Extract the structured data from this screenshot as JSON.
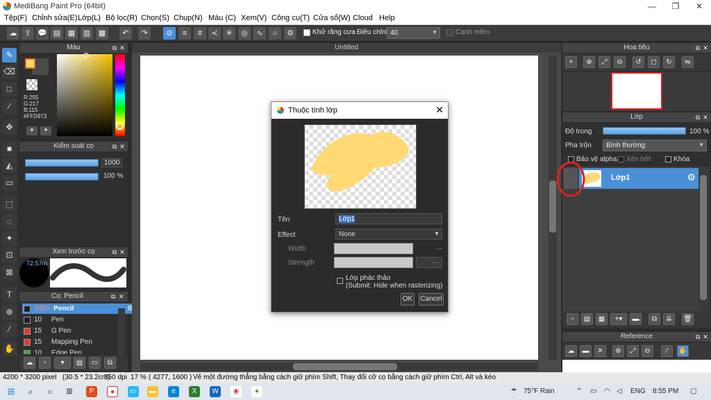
{
  "app": {
    "title": "MediBang Paint Pro (64bit)",
    "window_buttons": [
      "—",
      "❐",
      "✕"
    ]
  },
  "menu": [
    "Tệp(F)",
    "Chỉnh sửa(E)",
    "Lớp(L)",
    "Bộ lọc(R)",
    "Chọn(S)",
    "Chụp(N)",
    "Màu (C)",
    "Xem(V)",
    "Công cụ(T)",
    "Cửa sổ(W)",
    "Cloud",
    "Help"
  ],
  "toolbar": {
    "antialias_label": "Khử răng cưa",
    "adjust_label": "Điều chỉnh",
    "adjust_value": "40",
    "soft_edge_label": "Cạnh mềm"
  },
  "color_panel": {
    "title": "Màu",
    "r": "R:255",
    "g": "G:217",
    "b": "B:115",
    "hex": "#FFD973",
    "colors": {
      "primary": "#FFD973",
      "secondary": "#4a4a4a"
    }
  },
  "brush_control": {
    "title": "Kiểm soát cọ",
    "size": "1000",
    "opacity": "100 %"
  },
  "brush_preview": {
    "title": "Xem trước cọ",
    "size_label": "72.57m"
  },
  "brush_list": {
    "title": "Cọ: Pencil",
    "items": [
      {
        "size": "1000",
        "name": "Pencil",
        "color": "#222222",
        "selected": true
      },
      {
        "size": "10",
        "name": "Pen",
        "color": "#222222",
        "selected": false
      },
      {
        "size": "15",
        "name": "G Pen",
        "color": "#e53935",
        "selected": false
      },
      {
        "size": "15",
        "name": "Mapping Pen",
        "color": "#e53935",
        "selected": false
      },
      {
        "size": "10",
        "name": "Edge Pen",
        "color": "#43a047",
        "selected": false
      }
    ]
  },
  "canvas": {
    "tab_title": "Untitled"
  },
  "dialog": {
    "title": "Thuộc tính lớp",
    "name_label": "Tên",
    "name_value": "Lớp1",
    "effect_label": "Effect",
    "effect_value": "None",
    "width_label": "Width",
    "width_value": "---",
    "strength_label": "Strength",
    "strength_value": "---",
    "draft_label": "Lớp phác thảo",
    "draft_sub": "(Submit: Hide when rasterizing)",
    "ok": "OK",
    "cancel": "Cancel"
  },
  "navigator": {
    "title": "Hoa tiêu"
  },
  "layer_panel": {
    "title": "Lớp",
    "opacity_label": "Độ trong",
    "opacity_value": "100 %",
    "blend_label": "Pha trộn",
    "blend_value": "Bình thường",
    "protect_alpha": "Bảo vệ alpha",
    "clipping": "Xén bớt",
    "lock": "Khóa",
    "layer_name": "Lớp1",
    "colors": {
      "selected": "#4a90d9",
      "annotation": "#e02020"
    }
  },
  "reference": {
    "title": "Reference"
  },
  "status": {
    "size": "4200 * 3200 pixel",
    "cm": "(30.5 * 23.2cm)",
    "dpi": "350 dpi",
    "zoom": "17 %",
    "coords": "( 4277, 1600 )",
    "hint": "Vẽ một đường thẳng bằng cách giữ phím Shift, Thay đổi cỡ cọ bằng cách giữ phím Ctrl, Alt và kéo"
  },
  "taskbar": {
    "weather": "75°F  Rain",
    "lang": "ENG",
    "time": "8:55 PM"
  }
}
